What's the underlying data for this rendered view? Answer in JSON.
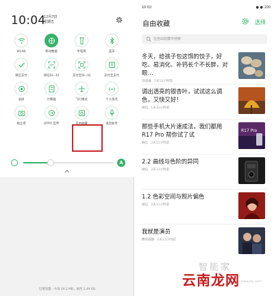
{
  "left": {
    "clock": "10:04",
    "date_line1": "12月7日",
    "date_line2": "星期五",
    "tiles": [
      {
        "label": "WLAN",
        "icon": "wifi-icon",
        "on": false
      },
      {
        "label": "移动数据",
        "icon": "mobile-data-icon",
        "on": true
      },
      {
        "label": "手电筒",
        "icon": "flashlight-icon",
        "on": false
      },
      {
        "label": "蓝牙",
        "icon": "bluetooth-icon",
        "on": false
      },
      {
        "label": "微信支付",
        "icon": "wechat-pay-icon",
        "on": false
      },
      {
        "label": "微信扫一扫",
        "icon": "scan-icon",
        "on": false
      },
      {
        "label": "支付宝扫一扫",
        "icon": "alipay-scan-icon",
        "on": false
      },
      {
        "label": "支付宝支付",
        "icon": "alipay-pay-icon",
        "on": false
      },
      {
        "label": "录屏",
        "icon": "screen-record-icon",
        "on": false
      },
      {
        "label": "计算器",
        "icon": "calculator-icon",
        "on": false
      },
      {
        "label": "飞行模式",
        "icon": "airplane-icon",
        "on": false
      },
      {
        "label": "个人热点",
        "icon": "hotspot-icon",
        "on": false
      },
      {
        "label": "拍立得",
        "icon": "camera-icon",
        "on": false
      },
      {
        "label": "OPPO 互传",
        "icon": "share-icon",
        "on": false
      },
      {
        "label": "自由收藏",
        "icon": "collect-icon",
        "on": false
      },
      {
        "label": "语音助手",
        "icon": "mic-icon",
        "on": false
      }
    ],
    "brightness_fraction": 0.3,
    "auto_brightness_label": "A",
    "storage_text": "已用流量：今日 18.2 MB，本月 2.49 GB"
  },
  "right": {
    "status_time": "10:02",
    "status_right": "● ● 100",
    "title": "自由收藏",
    "select_label": "选择",
    "search_placeholder": "在自由收藏中搜索",
    "items": [
      {
        "title": "冬天，给孩子包这饵的饺子，好吃、易消化、补钙长个不长胖，对眼…",
        "source": "浏览器",
        "time": "1天12小时前",
        "thumb": "oysters"
      },
      {
        "title": "调出透亮的银杏叶，试试这么调色，又快又好！",
        "source": "微信",
        "time": "1天12小时前",
        "thumb": "ginkgo"
      },
      {
        "title": "那些手机大片速成法，我们都用R17 Pro 帮你试了试",
        "source": "微信",
        "time": "2天11小时前",
        "thumb": "phone-ad"
      },
      {
        "title": "2.2 曲线与色阶的异同",
        "source": "微信",
        "time": "2天11小时前",
        "thumb": "camera"
      },
      {
        "title": "1.2 色彩空间与照片偏色",
        "source": "微信",
        "time": "2天11小时前",
        "thumb": "portrait"
      },
      {
        "title": "我就是演员",
        "source": "腾讯视频",
        "time": "2天11小时前",
        "thumb": "actors"
      }
    ]
  },
  "watermark": {
    "main": "云南龙网",
    "sub": "智能家",
    "url": "www.znj.com"
  },
  "colors": {
    "accent": "#36b26a",
    "highlight": "#c9272d"
  }
}
